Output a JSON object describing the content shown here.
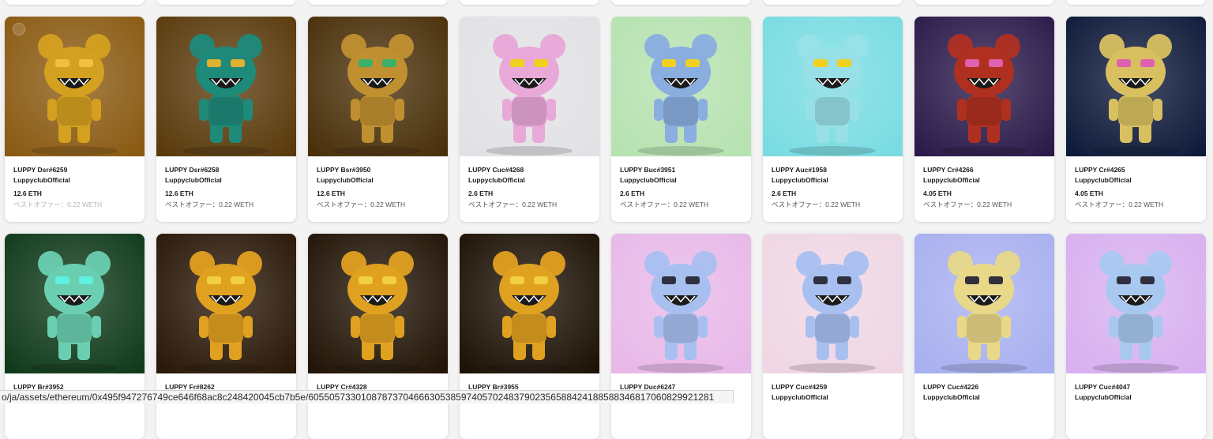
{
  "row1": [
    {
      "name": "LUPPY Dsr#6259",
      "collection": "LuppyclubOfficial",
      "price": "12.6 ETH",
      "offer": "ベストオファー：0.22 WETH",
      "offer_faded": true,
      "bg": "#8a5a12",
      "eye": "#f0c040",
      "body": "#d4a020"
    },
    {
      "name": "LUPPY Dsr#6258",
      "collection": "LuppyclubOfficial",
      "price": "12.6 ETH",
      "offer": "ベストオファー：0.22 WETH",
      "offer_faded": false,
      "bg": "#5a3a0c",
      "eye": "#e0b030",
      "body": "#1e8a7a"
    },
    {
      "name": "LUPPY Bsr#3950",
      "collection": "LuppyclubOfficial",
      "price": "12.6 ETH",
      "offer": "ベストオファー：0.22 WETH",
      "offer_faded": false,
      "bg": "#4a300a",
      "eye": "#3ab06a",
      "body": "#c09030"
    },
    {
      "name": "LUPPY Cuc#4268",
      "collection": "LuppyclubOfficial",
      "price": "2.6 ETH",
      "offer": "ベストオファー：0.22 WETH",
      "offer_faded": false,
      "bg": "#e2e2e6",
      "eye": "#f2d020",
      "body": "#e8a8d8"
    },
    {
      "name": "LUPPY Buc#3951",
      "collection": "LuppyclubOfficial",
      "price": "2.6 ETH",
      "offer": "ベストオファー：0.22 WETH",
      "offer_faded": false,
      "bg": "#b6e2b0",
      "eye": "#f2d020",
      "body": "#8aaee0"
    },
    {
      "name": "LUPPY Auc#1958",
      "collection": "LuppyclubOfficial",
      "price": "2.6 ETH",
      "offer": "ベストオファー：0.22 WETH",
      "offer_faded": false,
      "bg": "#78dce2",
      "eye": "#f2d020",
      "body": "#98e0e8"
    },
    {
      "name": "LUPPY Cr#4266",
      "collection": "LuppyclubOfficial",
      "price": "4.05 ETH",
      "offer": "ベストオファー：0.22 WETH",
      "offer_faded": false,
      "bg": "#2a1a4a",
      "eye": "#e060b0",
      "body": "#b03020"
    },
    {
      "name": "LUPPY Cr#4265",
      "collection": "LuppyclubOfficial",
      "price": "4.05 ETH",
      "offer": "ベストオファー：0.22 WETH",
      "offer_faded": false,
      "bg": "#0e1a3a",
      "eye": "#e060b0",
      "body": "#d8c060"
    }
  ],
  "row2": [
    {
      "name": "LUPPY Br#3952",
      "bg": "#0f3a1a",
      "eye": "#60f0e0",
      "body": "#6acfb0"
    },
    {
      "name": "LUPPY Fr#8262",
      "bg": "#2a1808",
      "eye": "#f0d040",
      "body": "#e0a020"
    },
    {
      "name": "LUPPY Cr#4328",
      "bg": "#221406",
      "eye": "#f0d040",
      "body": "#e0a020"
    },
    {
      "name": "LUPPY Br#3955",
      "bg": "#1e1206",
      "eye": "#f0d040",
      "body": "#e0a020"
    },
    {
      "name": "LUPPY Duc#6247",
      "bg": "#e8b8e8",
      "eye": "#303040",
      "body": "#a8c0f0"
    },
    {
      "name": "LUPPY Cuc#4259",
      "collection": "LuppyclubOfficial",
      "bg": "#efd6e4",
      "eye": "#303040",
      "body": "#a8c0f0"
    },
    {
      "name": "LUPPY Cuc#4226",
      "collection": "LuppyclubOfficial",
      "bg": "#a8b0f0",
      "eye": "#303040",
      "body": "#e8d888"
    },
    {
      "name": "LUPPY Cuc#4047",
      "collection": "LuppyclubOfficial",
      "bg": "#d8b0f0",
      "eye": "#303040",
      "body": "#a8c8f0"
    }
  ],
  "status_url": "o/ja/assets/ethereum/0x495f947276749ce646f68ac8c248420045cb7b5e/60550573301087873704666305385974057024837902356588424188588346817060829921281"
}
